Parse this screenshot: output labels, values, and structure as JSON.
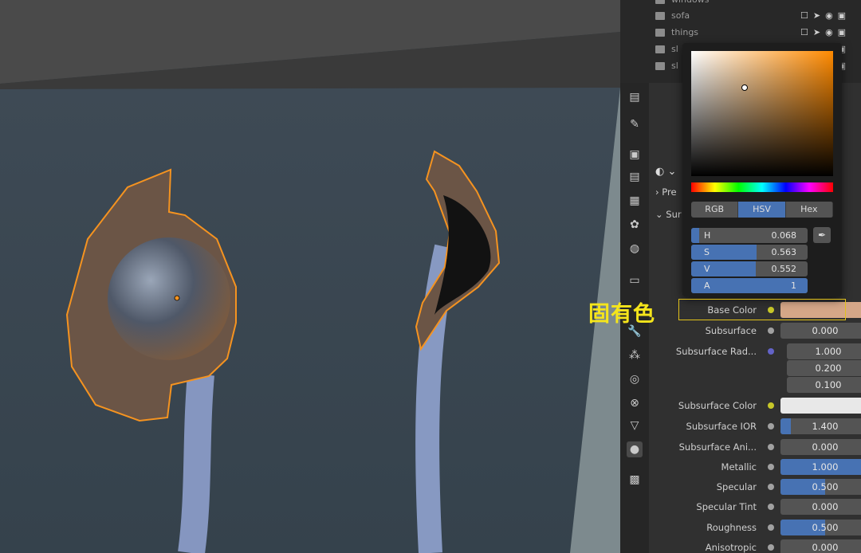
{
  "outliner": {
    "rows": [
      {
        "label": "windows"
      },
      {
        "label": "sofa"
      },
      {
        "label": "things"
      },
      {
        "label": "sl"
      },
      {
        "label": "sl"
      }
    ]
  },
  "sections": {
    "preview_label": "Pre",
    "surface_label": "Sur"
  },
  "color_picker": {
    "modes": [
      "RGB",
      "HSV",
      "Hex"
    ],
    "active_mode": "HSV",
    "fields": [
      {
        "key": "H",
        "value": "0.068",
        "level": 0.068
      },
      {
        "key": "S",
        "value": "0.563",
        "level": 0.563
      },
      {
        "key": "V",
        "value": "0.552",
        "level": 0.552
      },
      {
        "key": "A",
        "value": "1",
        "level": 1.0
      }
    ],
    "color_hex": "#d5a788"
  },
  "annotation": {
    "text": "固有色",
    "color": "#f5e51b"
  },
  "properties": [
    {
      "label": "Base Color",
      "type": "color",
      "socket": "yellow"
    },
    {
      "label": "Subsurface",
      "value": "0.000",
      "level": 0
    },
    {
      "label": "Subsurface Rad...",
      "values": [
        "1.000",
        "0.200",
        "0.100"
      ],
      "socket": "blue"
    },
    {
      "label": "Subsurface Color",
      "type": "white",
      "socket": "yellow"
    },
    {
      "label": "Subsurface IOR",
      "value": "1.400",
      "level": 0.12
    },
    {
      "label": "Subsurface Ani...",
      "value": "0.000",
      "level": 0
    },
    {
      "label": "Metallic",
      "value": "1.000",
      "level": 1.0
    },
    {
      "label": "Specular",
      "value": "0.500",
      "level": 0.5
    },
    {
      "label": "Specular Tint",
      "value": "0.000",
      "level": 0
    },
    {
      "label": "Roughness",
      "value": "0.500",
      "level": 0.5
    },
    {
      "label": "Anisotropic",
      "value": "0.000",
      "level": 0
    }
  ]
}
